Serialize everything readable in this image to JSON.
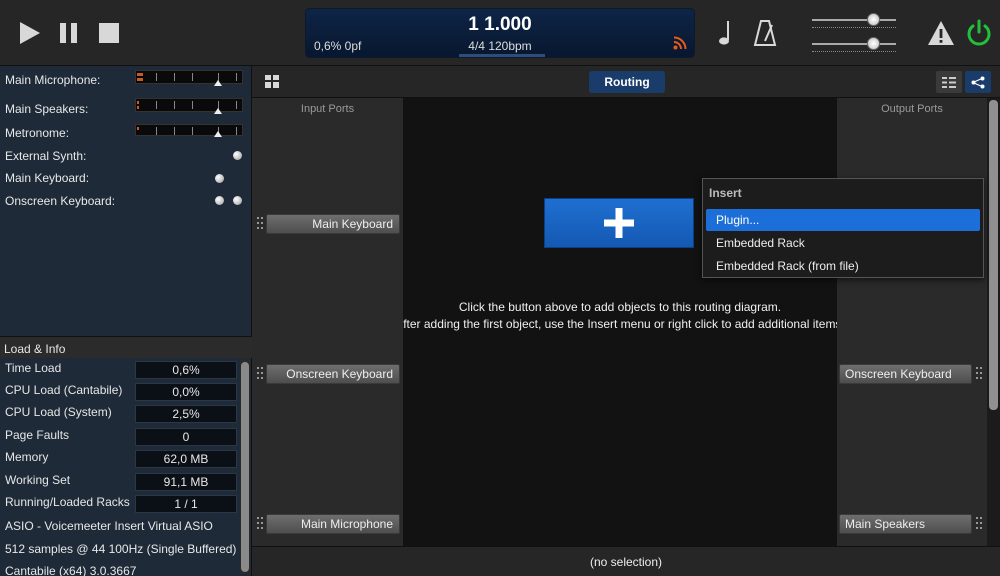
{
  "transport": {
    "position": "1 1.000",
    "load_pf": "0,6%  0pf",
    "tempo": "4/4 120bpm"
  },
  "ports": {
    "items": [
      {
        "label": "Main Microphone:",
        "kind": "meter"
      },
      {
        "label": "Main Speakers:",
        "kind": "meter"
      },
      {
        "label": "Metronome:",
        "kind": "meter"
      },
      {
        "label": "External Synth:",
        "kind": "dot"
      },
      {
        "label": "Main Keyboard:",
        "kind": "dot"
      },
      {
        "label": "Onscreen Keyboard:",
        "kind": "two-dots"
      }
    ]
  },
  "info": {
    "header": "Load & Info",
    "rows": [
      {
        "label": "Time Load",
        "value": "0,6%"
      },
      {
        "label": "CPU Load (Cantabile)",
        "value": "0,0%"
      },
      {
        "label": "CPU Load (System)",
        "value": "2,5%"
      },
      {
        "label": "Page Faults",
        "value": "0"
      },
      {
        "label": "Memory",
        "value": "62,0 MB"
      },
      {
        "label": "Working Set",
        "value": "91,1 MB"
      },
      {
        "label": "Running/Loaded Racks",
        "value": "1 / 1"
      }
    ],
    "lines": [
      "ASIO - Voicemeeter Insert Virtual ASIO",
      "512 samples @ 44 100Hz (Single Buffered)",
      "Cantabile (x64) 3.0.3667"
    ]
  },
  "routing": {
    "tab_label": "Routing",
    "input_title": "Input Ports",
    "output_title": "Output Ports",
    "inputs": [
      "Main Keyboard",
      "Onscreen Keyboard",
      "Main Microphone"
    ],
    "outputs": [
      "Onscreen Keyboard",
      "Main Speakers"
    ],
    "hint_line1": "Click the button above to add objects to this routing diagram.",
    "hint_line2": "After adding the first object, use the Insert menu or right click to add additional items."
  },
  "insert_menu": {
    "title": "Insert",
    "items": [
      "Plugin...",
      "Embedded Rack",
      "Embedded Rack (from file)"
    ],
    "selected_index": 0
  },
  "status_bar": "(no selection)",
  "colors": {
    "accent_blue": "#1c6fd8",
    "tab_blue": "#1a3c6a",
    "power_green": "#22c03a",
    "rss_orange": "#e85a1a"
  }
}
